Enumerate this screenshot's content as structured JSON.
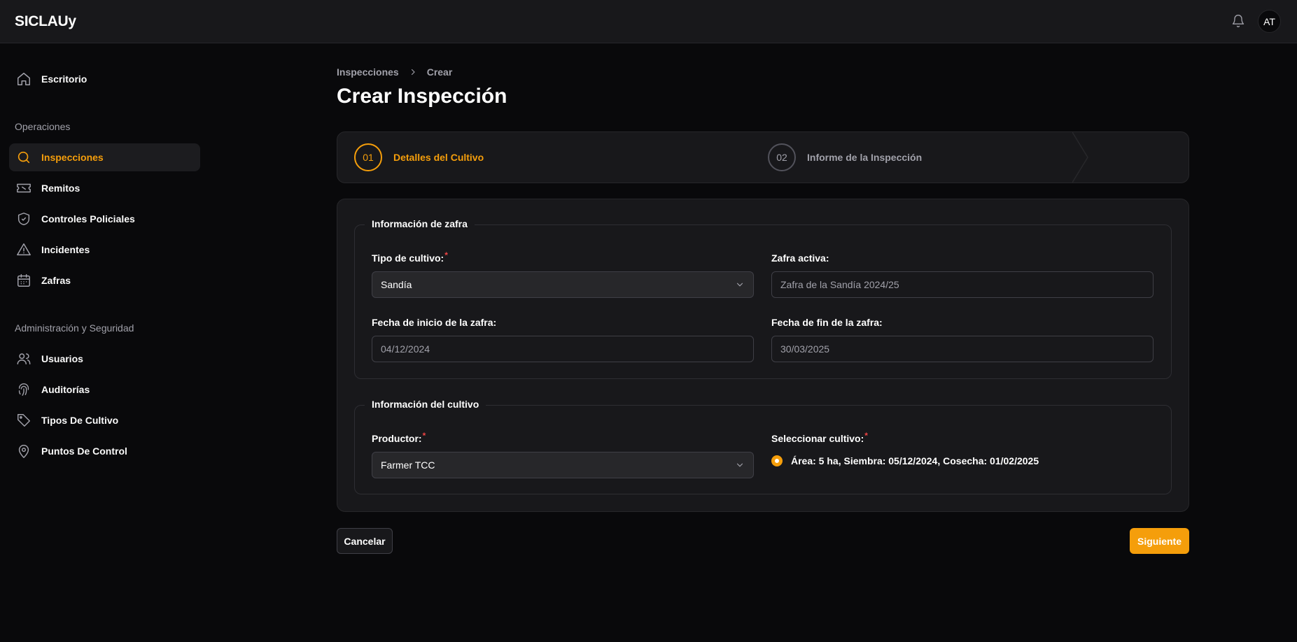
{
  "app": {
    "brand": "SICLAUy",
    "avatar_initials": "AT"
  },
  "colors": {
    "accent": "#f59e0b",
    "required": "#ef4444",
    "background": "#09090b",
    "surface": "#18181b"
  },
  "sidebar": {
    "top_item": {
      "label": "Escritorio",
      "icon": "home-icon"
    },
    "sections": [
      {
        "title": "Operaciones",
        "items": [
          {
            "label": "Inspecciones",
            "icon": "search-icon",
            "active": true
          },
          {
            "label": "Remitos",
            "icon": "ticket-icon"
          },
          {
            "label": "Controles Policiales",
            "icon": "shield-check-icon"
          },
          {
            "label": "Incidentes",
            "icon": "warning-icon"
          },
          {
            "label": "Zafras",
            "icon": "calendar-icon"
          }
        ]
      },
      {
        "title": "Administración y Seguridad",
        "items": [
          {
            "label": "Usuarios",
            "icon": "users-icon"
          },
          {
            "label": "Auditorías",
            "icon": "fingerprint-icon"
          },
          {
            "label": "Tipos De Cultivo",
            "icon": "tag-icon"
          },
          {
            "label": "Puntos De Control",
            "icon": "map-pin-icon"
          }
        ]
      }
    ]
  },
  "breadcrumb": {
    "items": [
      "Inspecciones",
      "Crear"
    ]
  },
  "page": {
    "title": "Crear Inspección"
  },
  "steps": [
    {
      "number": "01",
      "label": "Detalles del Cultivo",
      "current": true
    },
    {
      "number": "02",
      "label": "Informe de la Inspección",
      "current": false
    }
  ],
  "form": {
    "zafra_section": {
      "legend": "Información de zafra",
      "tipo_cultivo": {
        "label": "Tipo de cultivo:",
        "required_mark": "*",
        "value": "Sandía"
      },
      "zafra_activa": {
        "label": "Zafra activa:",
        "value": "Zafra de la Sandía 2024/25"
      },
      "fecha_inicio": {
        "label": "Fecha de inicio de la zafra:",
        "value": "04/12/2024"
      },
      "fecha_fin": {
        "label": "Fecha de fin de la zafra:",
        "value": "30/03/2025"
      }
    },
    "cultivo_section": {
      "legend": "Información del cultivo",
      "productor": {
        "label": "Productor:",
        "required_mark": "*",
        "value": "Farmer TCC"
      },
      "seleccionar_cultivo": {
        "label": "Seleccionar cultivo:",
        "required_mark": "*",
        "options": [
          {
            "label": "Área: 5 ha, Siembra: 05/12/2024, Cosecha: 01/02/2025",
            "selected": true
          }
        ]
      }
    }
  },
  "actions": {
    "cancel_label": "Cancelar",
    "next_label": "Siguiente"
  }
}
